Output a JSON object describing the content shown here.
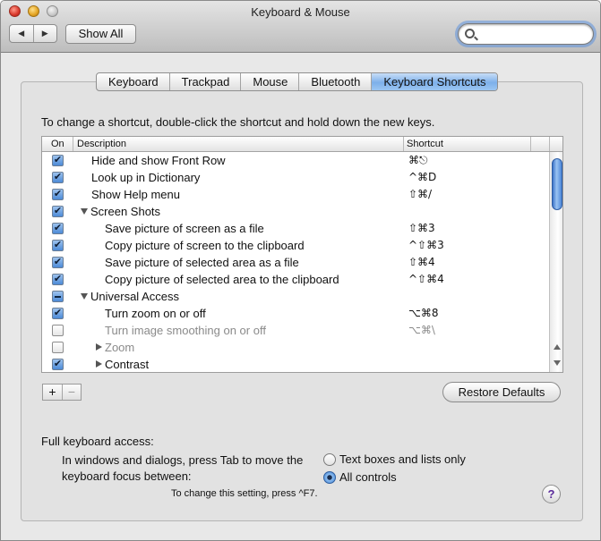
{
  "window": {
    "title": "Keyboard & Mouse"
  },
  "toolbar": {
    "back_glyph": "◀",
    "forward_glyph": "▶",
    "show_all_label": "Show All",
    "search_value": "",
    "search_placeholder": ""
  },
  "tabs": [
    {
      "label": "Keyboard",
      "selected": false
    },
    {
      "label": "Trackpad",
      "selected": false
    },
    {
      "label": "Mouse",
      "selected": false
    },
    {
      "label": "Bluetooth",
      "selected": false
    },
    {
      "label": "Keyboard Shortcuts",
      "selected": true
    }
  ],
  "instruction": "To change a shortcut, double-click the shortcut and hold down the new keys.",
  "table": {
    "columns": {
      "on": "On",
      "description": "Description",
      "shortcut": "Shortcut"
    },
    "rows": [
      {
        "state": "on",
        "description": "Hide and show Front Row",
        "shortcut": "⌘⎋",
        "level": 0
      },
      {
        "state": "on",
        "description": "Look up in Dictionary",
        "shortcut": "^⌘D",
        "level": 0
      },
      {
        "state": "on",
        "description": "Show Help menu",
        "shortcut": "⇧⌘/",
        "level": 0
      },
      {
        "state": "on",
        "description": "Screen Shots",
        "shortcut": "",
        "level": -1,
        "disclosure": "open"
      },
      {
        "state": "on",
        "description": "Save picture of screen as a file",
        "shortcut": "⇧⌘3",
        "level": 1
      },
      {
        "state": "on",
        "description": "Copy picture of screen to the clipboard",
        "shortcut": "^⇧⌘3",
        "level": 1
      },
      {
        "state": "on",
        "description": "Save picture of selected area as a file",
        "shortcut": "⇧⌘4",
        "level": 1
      },
      {
        "state": "on",
        "description": "Copy picture of selected area to the clipboard",
        "shortcut": "^⇧⌘4",
        "level": 1
      },
      {
        "state": "mixed",
        "description": "Universal Access",
        "shortcut": "",
        "level": -1,
        "disclosure": "open"
      },
      {
        "state": "on",
        "description": "Turn zoom on or off",
        "shortcut": "⌥⌘8",
        "level": 1
      },
      {
        "state": "off",
        "description": "Turn image smoothing on or off",
        "shortcut": "⌥⌘\\",
        "level": 1,
        "dim": true
      },
      {
        "state": "off",
        "description": "Zoom",
        "shortcut": "",
        "level": 1,
        "disclosure": "closed",
        "dim": true
      },
      {
        "state": "on",
        "description": "Contrast",
        "shortcut": "",
        "level": 1,
        "disclosure": "closed"
      }
    ]
  },
  "buttons": {
    "add": "+",
    "remove": "−",
    "restore_defaults": "Restore Defaults",
    "help": "?"
  },
  "keyboard_access": {
    "heading": "Full keyboard access:",
    "description": "In windows and dialogs, press Tab to move the keyboard focus between:",
    "options": [
      {
        "label": "Text boxes and lists only",
        "selected": false
      },
      {
        "label": "All controls",
        "selected": true
      }
    ],
    "footnote": "To change this setting, press ^F7."
  }
}
